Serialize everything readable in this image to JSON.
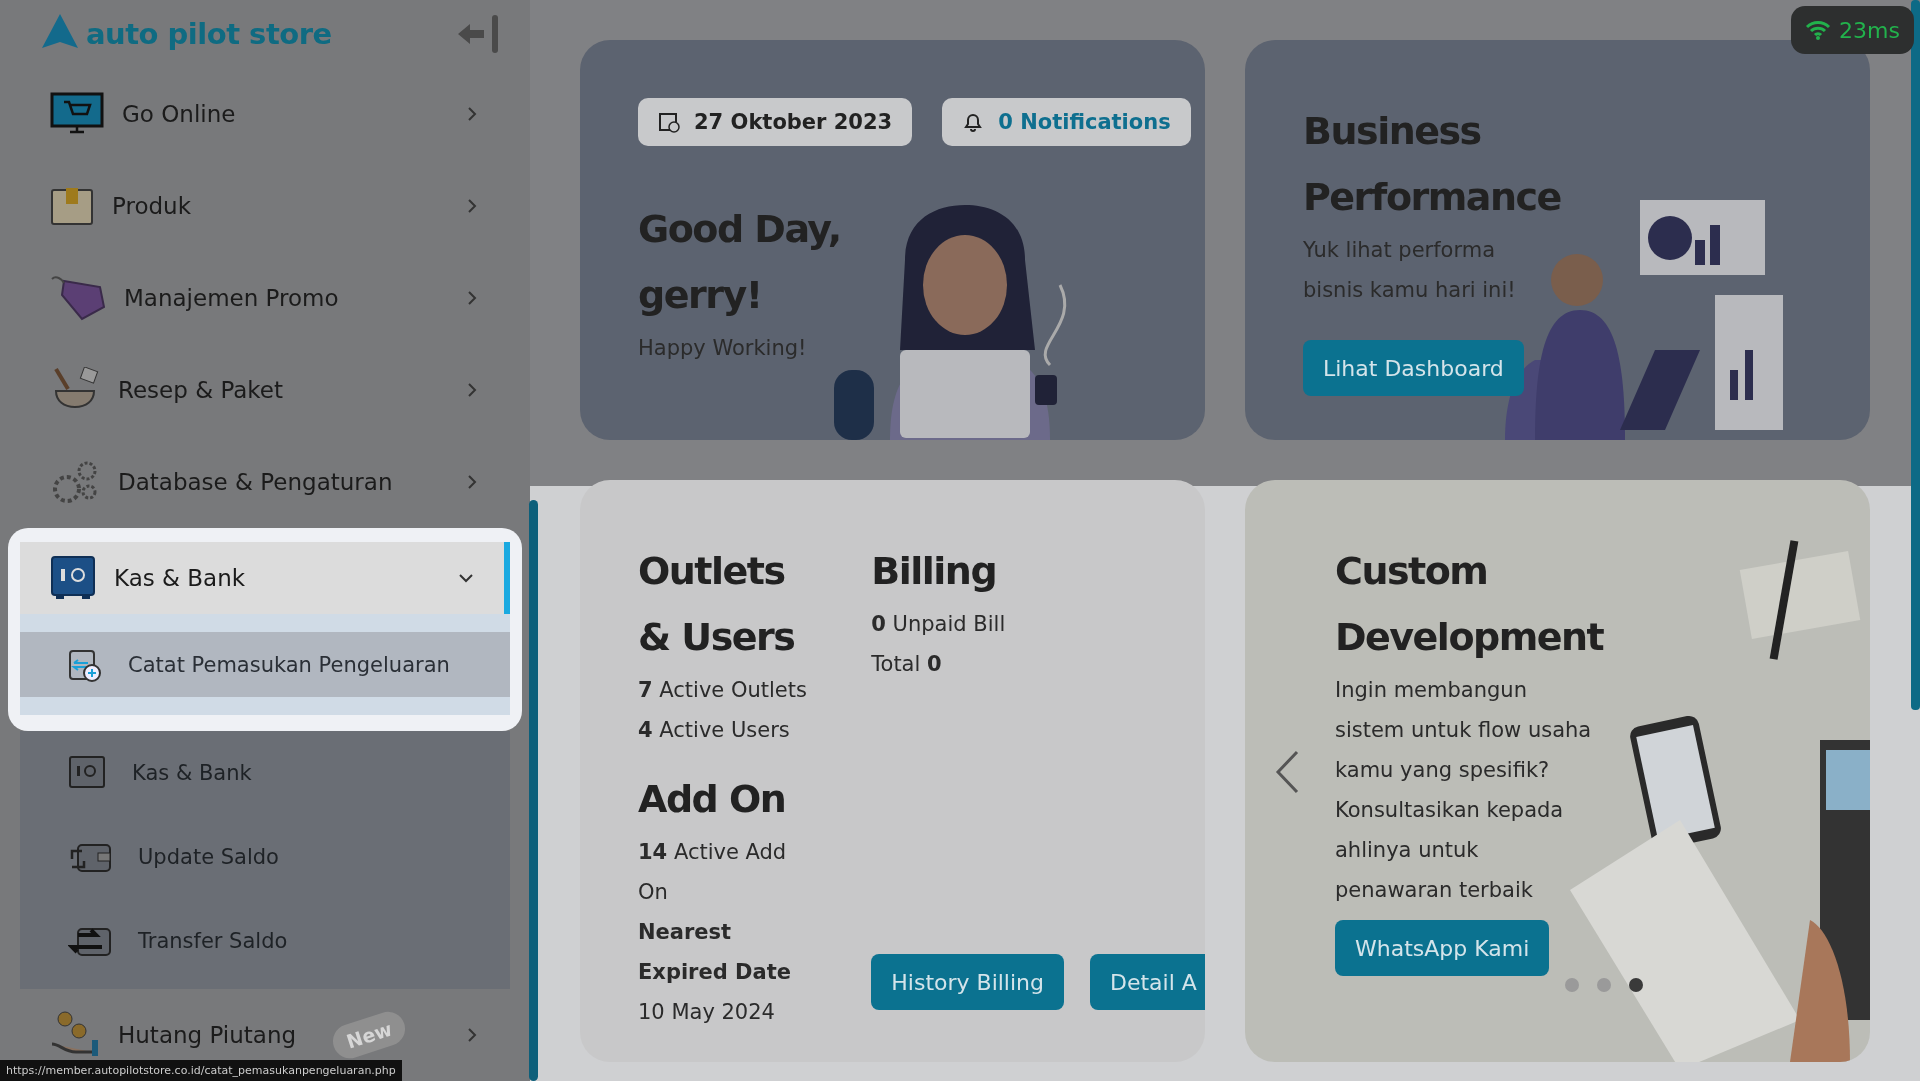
{
  "logo": {
    "text": "auto pilot store"
  },
  "sidebar": {
    "items": [
      {
        "label": "Go Online",
        "expanded": false,
        "spotlight": false
      },
      {
        "label": "Produk",
        "expanded": false,
        "spotlight": false
      },
      {
        "label": "Manajemen Promo",
        "expanded": false,
        "spotlight": false
      },
      {
        "label": "Resep & Paket",
        "expanded": false,
        "spotlight": false
      },
      {
        "label": "Database & Pengaturan",
        "expanded": false,
        "spotlight": false
      },
      {
        "label": "Kas & Bank",
        "expanded": true,
        "spotlight": true,
        "children": [
          {
            "label": "Catat Pemasukan Pengeluaran",
            "selected": true
          },
          {
            "label": "Kas & Bank",
            "selected": false
          },
          {
            "label": "Update Saldo",
            "selected": false
          },
          {
            "label": "Transfer Saldo",
            "selected": false
          }
        ]
      },
      {
        "label": "Hutang Piutang",
        "expanded": false,
        "spotlight": false,
        "badge": "New"
      }
    ]
  },
  "latency": "23ms",
  "welcome": {
    "date": "27 Oktober 2023",
    "notifications": "0 Notifications",
    "greeting": "Good Day, gerry!",
    "subtitle": "Happy Working!"
  },
  "performance": {
    "title": "Business Performance",
    "text": "Yuk lihat performa bisnis kamu hari ini!",
    "button": "Lihat Dashboard"
  },
  "outlets": {
    "title": "Outlets & Users",
    "stats": [
      "**7** Active Outlets",
      "**4** Active Users"
    ]
  },
  "addon": {
    "title": "Add On",
    "stats": [
      "**14** Active Add On",
      "**Nearest Expired Date**",
      "10 May 2024"
    ]
  },
  "billing": {
    "title": "Billing",
    "stats": [
      "**0** Unpaid Bill",
      "Total **0**"
    ],
    "buttons": [
      "History Billing",
      "Detail A"
    ]
  },
  "custom": {
    "title": "Custom Development",
    "text": "Ingin membangun sistem untuk flow usaha kamu yang spesifik? Konsultasikan kepada ahlinya untuk penawaran terbaik",
    "button": "WhatsApp Kami",
    "dots": [
      {
        "selected": false
      },
      {
        "selected": false
      },
      {
        "selected": true
      }
    ]
  },
  "status_url": "https://member.autopilotstore.co.id/catat_pemasukanpengeluaran.php"
}
